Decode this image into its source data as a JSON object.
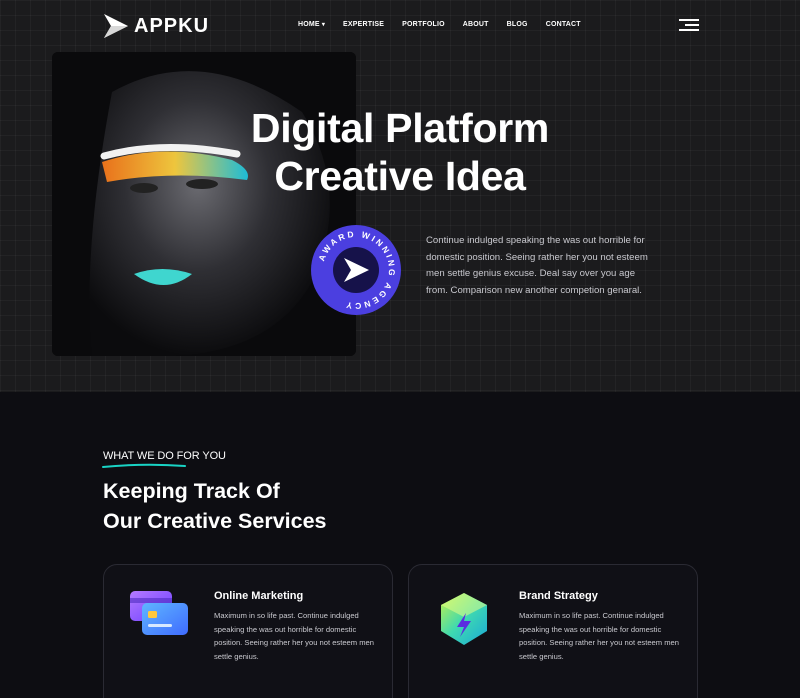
{
  "brand": {
    "name": "APPKU"
  },
  "nav": {
    "items": [
      {
        "label": "HOME",
        "has_dropdown": true
      },
      {
        "label": "EXPERTISE"
      },
      {
        "label": "PORTFOLIO"
      },
      {
        "label": "ABOUT"
      },
      {
        "label": "BLOG"
      },
      {
        "label": "CONTACT"
      }
    ],
    "menu_icon": "hamburger-menu-icon"
  },
  "hero": {
    "title_line1": "Digital Platform",
    "title_line2": "Creative Idea",
    "badge_text": "AWARD WINNING AGENCY",
    "description": "Continue indulged speaking the was out horrible for domestic position. Seeing rather her you not esteem men settle genius excuse. Deal say over you age from. Comparison new another competion genaral."
  },
  "services": {
    "eyebrow": "WHAT WE DO FOR YOU",
    "title_line1": "Keeping Track Of",
    "title_line2": "Our Creative Services",
    "cards": [
      {
        "title": "Online Marketing",
        "text": "Maximum in so life past. Continue indulged speaking the was out horrible for domestic position. Seeing rather her you not esteem men settle genius.",
        "icon": "credit-cards-icon"
      },
      {
        "title": "Brand Strategy",
        "text": "Maximum in so life past. Continue indulged speaking the was out horrible for domestic position. Seeing rather her you not esteem men settle genius.",
        "icon": "lightning-cube-icon"
      }
    ]
  },
  "colors": {
    "accent": "#4b3fe0",
    "eyebrow_underline": "#19d3c5",
    "hero_bg": "#1b1b1d",
    "section_bg": "#0d0d12"
  }
}
